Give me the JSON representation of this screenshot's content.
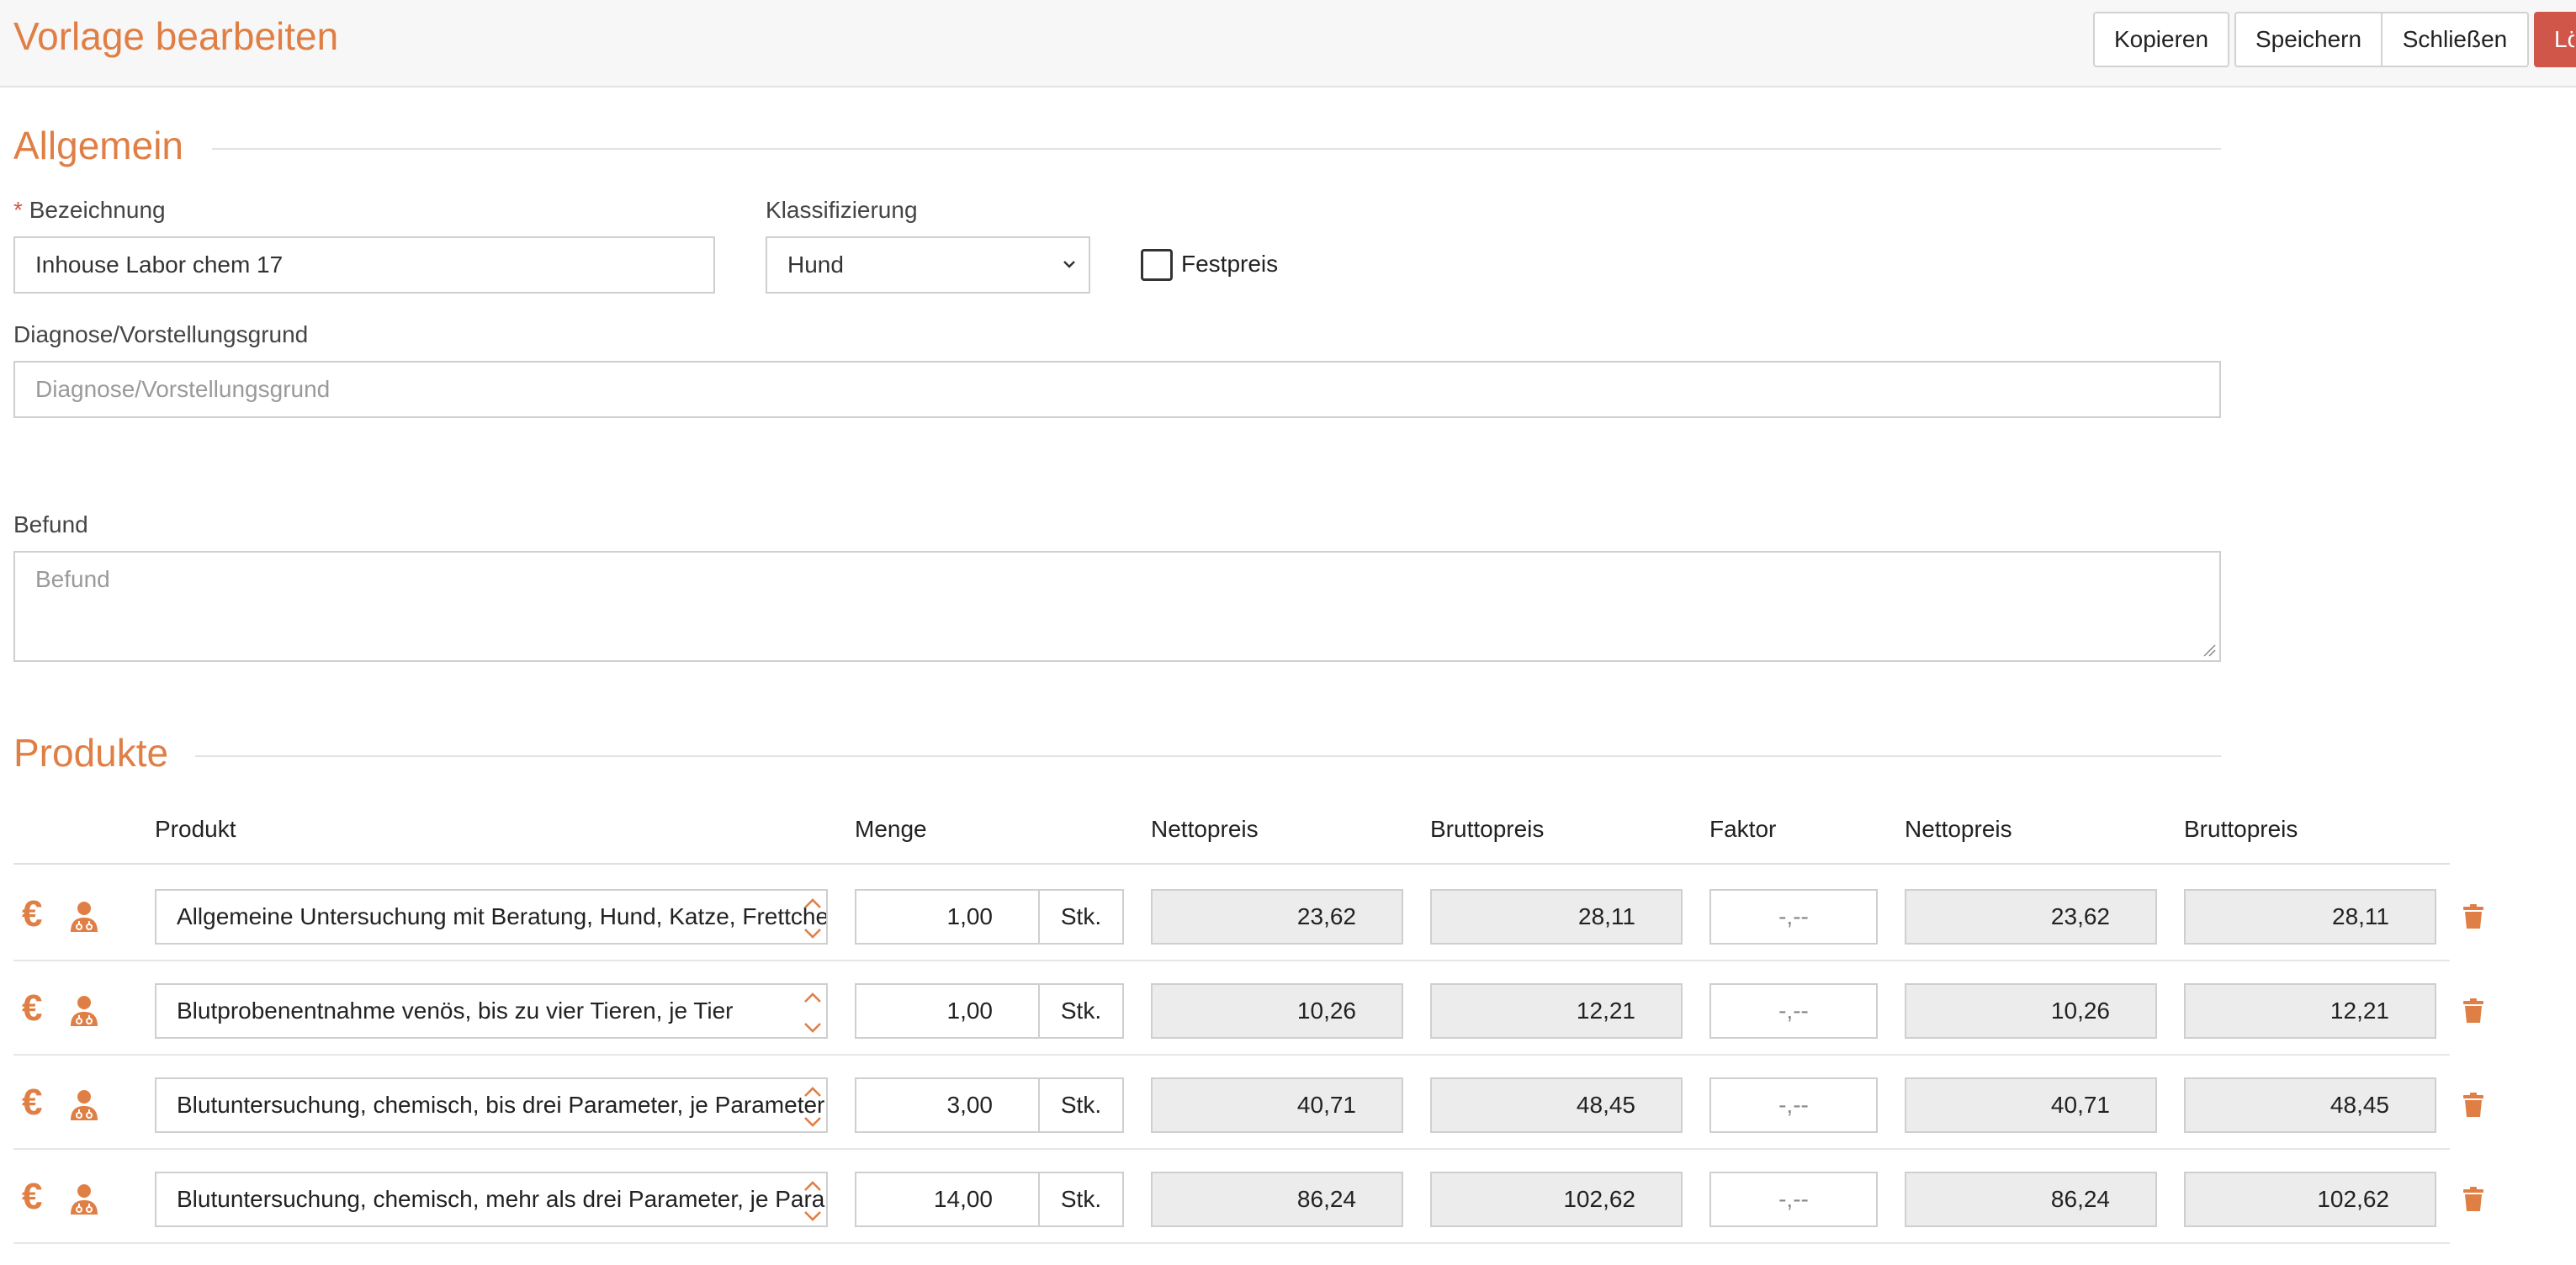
{
  "header": {
    "title": "Vorlage bearbeiten",
    "buttons": {
      "copy": "Kopieren",
      "save": "Speichern",
      "close": "Schließen",
      "delete": "Lö"
    }
  },
  "general": {
    "section_title": "Allgemein",
    "name": {
      "label": "Bezeichnung",
      "required_mark": "*",
      "value": "Inhouse Labor chem 17"
    },
    "classification": {
      "label": "Klassifizierung",
      "value": "Hund"
    },
    "fixed_price": {
      "label": "Festpreis",
      "checked": false
    },
    "diagnosis": {
      "label": "Diagnose/Vorstellungsgrund",
      "placeholder": "Diagnose/Vorstellungsgrund"
    },
    "findings": {
      "label": "Befund",
      "placeholder": "Befund"
    }
  },
  "products": {
    "section_title": "Produkte",
    "columns": {
      "product": "Produkt",
      "quantity": "Menge",
      "net_price": "Nettopreis",
      "gross_price": "Bruttopreis",
      "factor": "Faktor",
      "net_price_2": "Nettopreis",
      "gross_price_2": "Bruttopreis"
    },
    "euro_symbol": "€",
    "rows": [
      {
        "product": "Allgemeine Untersuchung mit Beratung, Hund, Katze, Frettchen",
        "quantity": "1,00",
        "unit": "Stk.",
        "net": "23,62",
        "gross": "28,11",
        "factor": "-,--",
        "net2": "23,62",
        "gross2": "28,11"
      },
      {
        "product": "Blutprobenentnahme venös, bis zu vier Tieren, je Tier",
        "quantity": "1,00",
        "unit": "Stk.",
        "net": "10,26",
        "gross": "12,21",
        "factor": "-,--",
        "net2": "10,26",
        "gross2": "12,21"
      },
      {
        "product": "Blutuntersuchung, chemisch, bis drei Parameter, je Parameter",
        "quantity": "3,00",
        "unit": "Stk.",
        "net": "40,71",
        "gross": "48,45",
        "factor": "-,--",
        "net2": "40,71",
        "gross2": "48,45"
      },
      {
        "product": "Blutuntersuchung, chemisch, mehr als drei Parameter, je Parameter",
        "quantity": "14,00",
        "unit": "Stk.",
        "net": "86,24",
        "gross": "102,62",
        "factor": "-,--",
        "net2": "86,24",
        "gross2": "102,62"
      }
    ]
  },
  "colors": {
    "accent": "#e07f45",
    "danger": "#d0564a",
    "readonly_bg": "#ececec",
    "border": "#cfcfcf"
  },
  "icons": [
    "euro-icon",
    "vet-icon",
    "trash-icon",
    "chevron-up-icon",
    "chevron-down-icon"
  ]
}
